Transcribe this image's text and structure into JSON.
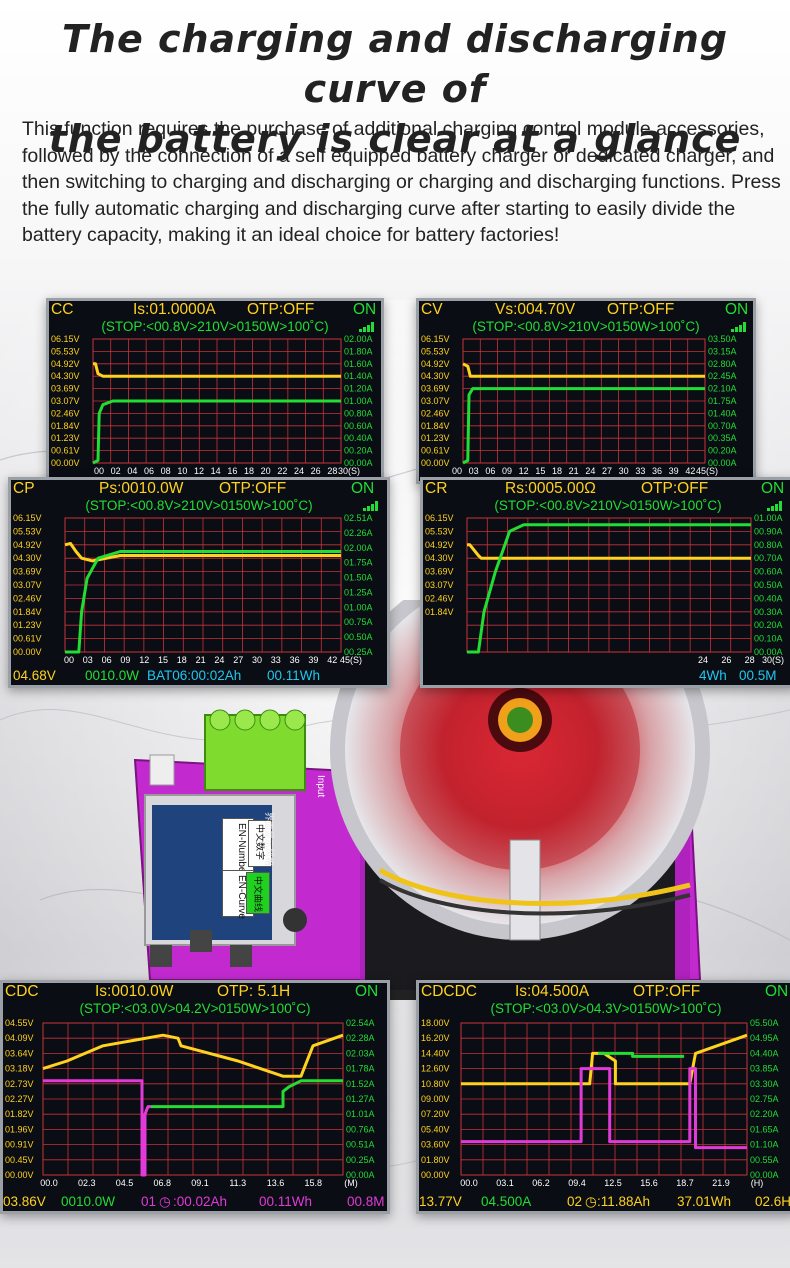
{
  "headline": {
    "line1": "The charging and discharging curve of",
    "line2": "the battery is clear at a glance"
  },
  "intro": "This function requires the purchase of additional charging control module accessories, followed by the connection of a self equipped battery charger or dedicated charger, and then switching to charging and discharging or charging and discharging functions. Press the fully automatic charging and discharging curve after starting to easily divide the battery capacity, making it  an ideal choice for battery factories!",
  "colors": {
    "screen_bg": "#0a0d14",
    "grid": "#c8323a",
    "voltage_trace": "#ffd21f",
    "current_trace": "#22dd33",
    "alt_current_trace": "#e23ad8",
    "label_green": "#22dd33",
    "header_yellow": "#ffd21f",
    "label_cyan": "#1ec8f0"
  },
  "screens": {
    "cc": {
      "mode": "CC",
      "setting": "Is:01.0000A",
      "otp": "OTP:OFF",
      "status": "ON",
      "stop": "(STOP:<00.8V>210V>0150W>100˚C)",
      "y_left": [
        "06.15V",
        "05.53V",
        "04.92V",
        "04.30V",
        "03.69V",
        "03.07V",
        "02.46V",
        "01.84V",
        "01.23V",
        "00.61V",
        "00.00V"
      ],
      "y_right": [
        "02.00A",
        "01.80A",
        "01.60A",
        "01.40A",
        "01.20A",
        "01.00A",
        "00.80A",
        "00.60A",
        "00.40A",
        "00.20A",
        "00.00A"
      ],
      "x_ticks": [
        "00",
        "02",
        "04",
        "06",
        "08",
        "10",
        "12",
        "14",
        "16",
        "18",
        "20",
        "22",
        "24",
        "26",
        "28",
        "30(S)"
      ]
    },
    "cv": {
      "mode": "CV",
      "setting": "Vs:004.70V",
      "otp": "OTP:OFF",
      "status": "ON",
      "stop": "(STOP:<00.8V>210V>0150W>100˚C)",
      "y_left": [
        "06.15V",
        "05.53V",
        "04.92V",
        "04.30V",
        "03.69V",
        "03.07V",
        "02.46V",
        "01.84V",
        "01.23V",
        "00.61V",
        "00.00V"
      ],
      "y_right": [
        "03.50A",
        "03.15A",
        "02.80A",
        "02.45A",
        "02.10A",
        "01.75A",
        "01.40A",
        "00.70A",
        "00.35A",
        "00.20A",
        "00.00A"
      ],
      "x_ticks": [
        "00",
        "03",
        "06",
        "09",
        "12",
        "15",
        "18",
        "21",
        "24",
        "27",
        "30",
        "33",
        "36",
        "39",
        "42",
        "45(S)"
      ]
    },
    "cp": {
      "mode": "CP",
      "setting": "Ps:0010.0W",
      "otp": "OTP:OFF",
      "status": "ON",
      "stop": "(STOP:<00.8V>210V>0150W>100˚C)",
      "y_left": [
        "06.15V",
        "05.53V",
        "04.92V",
        "04.30V",
        "03.69V",
        "03.07V",
        "02.46V",
        "01.84V",
        "01.23V",
        "00.61V",
        "00.00V"
      ],
      "y_right": [
        "02.51A",
        "02.26A",
        "02.00A",
        "01.75A",
        "01.50A",
        "01.25A",
        "01.00A",
        "00.75A",
        "00.50A",
        "00.25A"
      ],
      "x_ticks": [
        "00",
        "03",
        "06",
        "09",
        "12",
        "15",
        "18",
        "21",
        "24",
        "27",
        "30",
        "33",
        "36",
        "39",
        "42",
        "45(S)"
      ],
      "footer": {
        "voltage": "04.68V",
        "power": "0010.0W",
        "battery_time": "BAT06:00:02Ah",
        "energy": "00.11Wh"
      }
    },
    "cr": {
      "mode": "CR",
      "setting": "Rs:0005.00Ω",
      "otp": "OTP:OFF",
      "status": "ON",
      "stop": "(STOP:<00.8V>210V>0150W>100˚C)",
      "y_left": [
        "06.15V",
        "05.53V",
        "04.92V",
        "04.30V",
        "03.69V",
        "03.07V",
        "02.46V",
        "01.84V"
      ],
      "y_right": [
        "01.00A",
        "00.90A",
        "00.80A",
        "00.70A",
        "00.60A",
        "00.50A",
        "00.40A",
        "00.30A",
        "00.20A",
        "00.10A",
        "00.00A"
      ],
      "x_ticks": [
        "24",
        "26",
        "28",
        "30(S)"
      ],
      "footer": {
        "power": "4Wh",
        "current": "00.5M"
      }
    },
    "cdc": {
      "mode": "CDC",
      "setting": "Is:0010.0W",
      "otp": "OTP: 5.1H",
      "status": "ON",
      "stop": "(STOP:<03.0V>04.2V>0150W>100˚C)",
      "y_left": [
        "04.55V",
        "04.09V",
        "03.64V",
        "03.18V",
        "02.73V",
        "02.27V",
        "01.82V",
        "01.96V",
        "00.91V",
        "00.45V",
        "00.00V"
      ],
      "y_right": [
        "02.54A",
        "02.28A",
        "02.03A",
        "01.78A",
        "01.52A",
        "01.27A",
        "01.01A",
        "00.76A",
        "00.51A",
        "00.25A",
        "00.00A"
      ],
      "x_ticks": [
        "00.0",
        "02.3",
        "04.5",
        "06.8",
        "09.1",
        "11.3",
        "13.6",
        "15.8",
        "(M)"
      ],
      "footer": {
        "voltage": "03.86V",
        "power": "0010.0W",
        "cycle": "01",
        "capacity": ":00.02Ah",
        "energy": "00.11Wh",
        "extra": "00.8M"
      }
    },
    "cdcdc": {
      "mode": "CDCDC",
      "setting": "Is:04.500A",
      "otp": "OTP:OFF",
      "status": "ON",
      "stop": "(STOP:<03.0V>04.3V>0150W>100˚C)",
      "y_left": [
        "18.00V",
        "16.20V",
        "14.40V",
        "12.60V",
        "10.80V",
        "09.00V",
        "07.20V",
        "05.40V",
        "03.60V",
        "01.80V",
        "00.00V"
      ],
      "y_right": [
        "05.50A",
        "04.95A",
        "04.40A",
        "03.85A",
        "03.30A",
        "02.75A",
        "02.20A",
        "01.65A",
        "01.10A",
        "00.55A",
        "00.00A"
      ],
      "x_ticks": [
        "00.0",
        "03.1",
        "06.2",
        "09.4",
        "12.5",
        "15.6",
        "18.7",
        "21.9",
        "(H)"
      ],
      "footer": {
        "voltage": "13.77V",
        "current": "04.500A",
        "cycle": "02",
        "capacity": ":11.88Ah",
        "energy": "37.01Wh",
        "extra": "02.6H"
      }
    }
  },
  "device": {
    "btn_number": "EN-Number",
    "btn_curve": "EN-Curve",
    "zh_number": "中文数字",
    "zh_curve": "中文曲线",
    "zh_title": "界面显示风格",
    "input_label": "Input"
  }
}
